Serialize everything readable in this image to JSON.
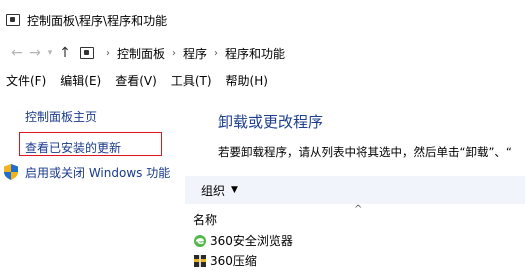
{
  "window": {
    "title": "控制面板\\程序\\程序和功能"
  },
  "nav": {
    "back": "←",
    "forward": "→",
    "recent": "▾",
    "up": "↑",
    "breadcrumbs": [
      "控制面板",
      "程序",
      "程序和功能"
    ],
    "separator": "›"
  },
  "menu": [
    "文件(F)",
    "编辑(E)",
    "查看(V)",
    "工具(T)",
    "帮助(H)"
  ],
  "left": {
    "home": "控制面板主页",
    "updates": "查看已安装的更新",
    "features": "启用或关闭 Windows 功能"
  },
  "main": {
    "title": "卸载或更改程序",
    "description": "若要卸载程序，请从列表中将其选中，然后单击“卸载”、“",
    "toolbar": {
      "organize": "组织",
      "organize_caret": "▼"
    },
    "sort_indicator": "^",
    "column_name": "名称",
    "programs": [
      {
        "name": "360安全浏览器",
        "icon": "360-browser-icon"
      },
      {
        "name": "360压缩",
        "icon": "360-zip-icon"
      }
    ]
  },
  "colors": {
    "link": "#1a3a8c",
    "highlight_border": "#e0141b",
    "heading": "#1e3f8e",
    "toolbar_bg": "#f1f5fb"
  }
}
